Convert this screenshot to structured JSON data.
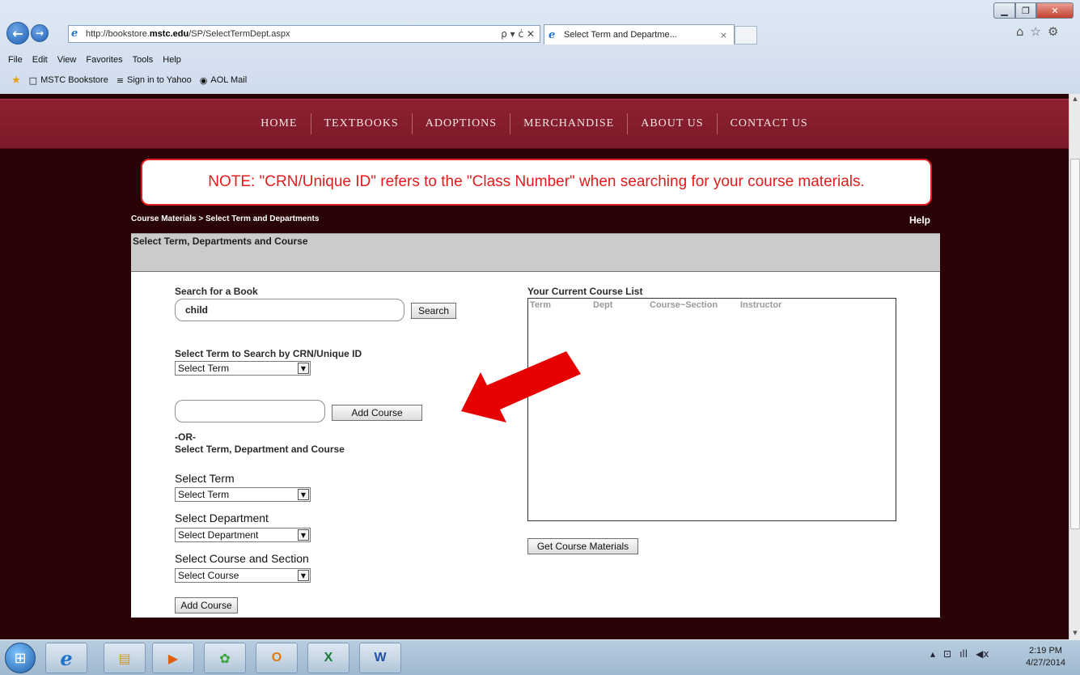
{
  "browser": {
    "url_prefix": "http://bookstore.",
    "url_domain": "mstc.edu",
    "url_path": "/SP/SelectTermDept.aspx",
    "address_tools": "ρ ▾ ċ ✕",
    "tab_title": "Select Term and Departme...",
    "tab_close": "×",
    "menu": [
      "File",
      "Edit",
      "View",
      "Favorites",
      "Tools",
      "Help"
    ],
    "favorites": [
      "MSTC Bookstore",
      "Sign in to Yahoo",
      "AOL Mail"
    ],
    "window_controls": {
      "minimize": "▁",
      "maximize": "❐",
      "close": "✕"
    },
    "chrome_icons": [
      "⌂",
      "☆",
      "⚙"
    ]
  },
  "site_nav": [
    "HOME",
    "TEXTBOOKS",
    "ADOPTIONS",
    "MERCHANDISE",
    "ABOUT US",
    "CONTACT US"
  ],
  "notice": "NOTE: \"CRN/Unique ID\" refers to the \"Class Number\" when searching for your course materials.",
  "breadcrumb": "Course Materials > Select Term and Departments",
  "help_link": "Help",
  "panel": {
    "title": "Select Term, Departments and Course",
    "search_label": "Search for a Book",
    "search_value": "child",
    "search_button": "Search",
    "crn_label": "Select Term to Search by CRN/Unique ID",
    "crn_term_select": "Select Term",
    "crn_input_value": "",
    "add_course_button": "Add Course",
    "or_label": "-OR-",
    "tdc_label": "Select Term, Department and Course",
    "term_label": "Select Term",
    "term_select": "Select Term",
    "dept_label": "Select Department",
    "dept_select": "Select Department",
    "course_label": "Select Course and Section",
    "course_select": "Select Course",
    "add_course_button2": "Add Course",
    "course_list_title": "Your Current Course List",
    "course_list_columns": [
      "Term",
      "Dept",
      "Course~Section",
      "Instructor"
    ],
    "get_materials_button": "Get Course Materials"
  },
  "taskbar": {
    "start_icon": "⊞",
    "apps": [
      {
        "name": "ie",
        "glyph": "e",
        "color": "#1e73d0"
      },
      {
        "name": "explorer",
        "glyph": "▤",
        "color": "#c99b2a"
      },
      {
        "name": "media",
        "glyph": "▶",
        "color": "#e06010"
      },
      {
        "name": "app",
        "glyph": "✿",
        "color": "#3aa23a"
      },
      {
        "name": "outlook",
        "glyph": "O",
        "color": "#e07a10"
      },
      {
        "name": "excel",
        "glyph": "X",
        "color": "#1d7a3a"
      },
      {
        "name": "word",
        "glyph": "W",
        "color": "#2250a8"
      }
    ],
    "tray_icons": [
      "▴",
      "⊡",
      "ıll",
      "◀ⅹ"
    ],
    "time": "2:19 PM",
    "date": "4/27/2014"
  },
  "colors": {
    "nav_bar": "#8e2030",
    "page_bg": "#2a0306",
    "notice_red": "#e01c1c",
    "arrow_red": "#e60000"
  }
}
